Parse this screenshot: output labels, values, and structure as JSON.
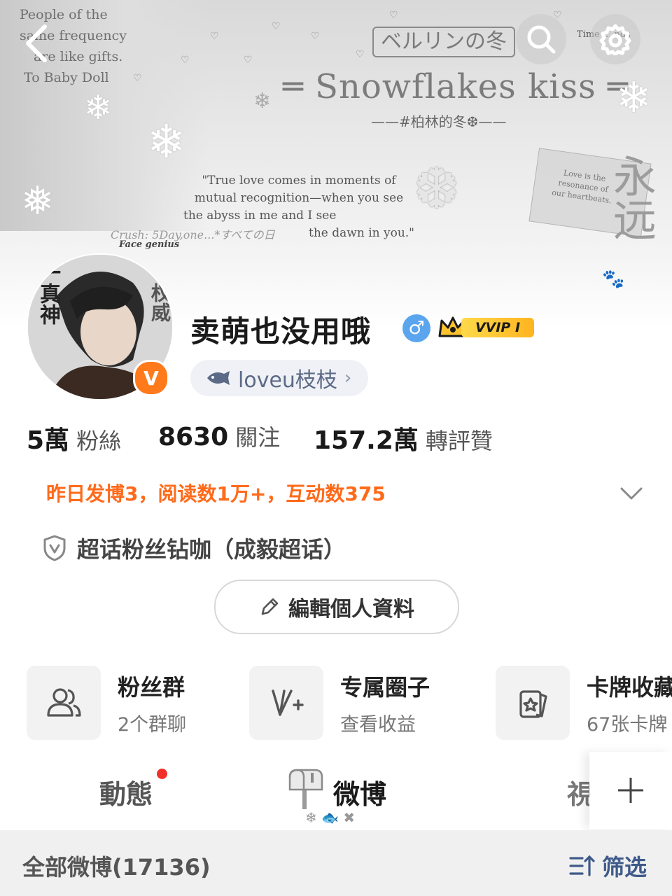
{
  "banner": {
    "top_left_lines": [
      "People of the",
      "same frequency",
      "are like gifts.",
      "To Baby Doll"
    ],
    "jp_title": "ベルリンの冬",
    "title": "Snowflakes kiss",
    "subtitle": "#柏林的冬",
    "quote_lines": [
      "\"True love comes in moments of",
      "mutual recognition—when you see",
      "the abyss in me and I see",
      "the dawn in you.\""
    ],
    "crush_line": "Crush: 5Day,one...*すべての日",
    "face_line": "Face genius",
    "card_text": [
      "Love is the",
      "resonance of",
      "our heartbeats."
    ],
    "kanji": "永远",
    "time_text": "Time ... nds",
    "avatar_side_text_left": "唯一真神",
    "avatar_side_text_right": "权威"
  },
  "header": {
    "back_icon": "back-arrow-icon",
    "search_icon": "search-icon",
    "settings_icon": "gear-icon"
  },
  "profile": {
    "username": "卖萌也没用哦",
    "gender_symbol": "♂",
    "vip_label": "VVIP I",
    "verified_letter": "V",
    "fan_pill_label": "loveu枝枝",
    "fan_pill_chevron": "›"
  },
  "stats": [
    {
      "num": "5萬",
      "label": "粉絲"
    },
    {
      "num": "8630",
      "label": "關注"
    },
    {
      "num": "157.2萬",
      "label": "轉評贊"
    }
  ],
  "yesterday_summary": "昨日发博3，阅读数1万+，互动数375",
  "super_topic": "超话粉丝钻咖（成毅超话）",
  "edit_profile_label": "編輯個人資料",
  "features": [
    {
      "title": "粉丝群",
      "sub": "2个群聊",
      "icon": "group-icon"
    },
    {
      "title": "专属圈子",
      "sub": "查看收益",
      "icon": "circle-v-icon"
    },
    {
      "title": "卡牌收藏",
      "sub": "67张卡牌",
      "icon": "card-icon"
    }
  ],
  "tabs": {
    "dynamic": "動態",
    "weibo": "微博",
    "video": "視"
  },
  "all_weibo": "全部微博(17136)",
  "filter_label": "筛选",
  "colors": {
    "accent_orange": "#ff6a1a",
    "filter_blue": "#3f5a8a",
    "vip_gold": "#ffc32d",
    "gender_blue": "#5aa5ee",
    "red_dot": "#f2302a"
  }
}
